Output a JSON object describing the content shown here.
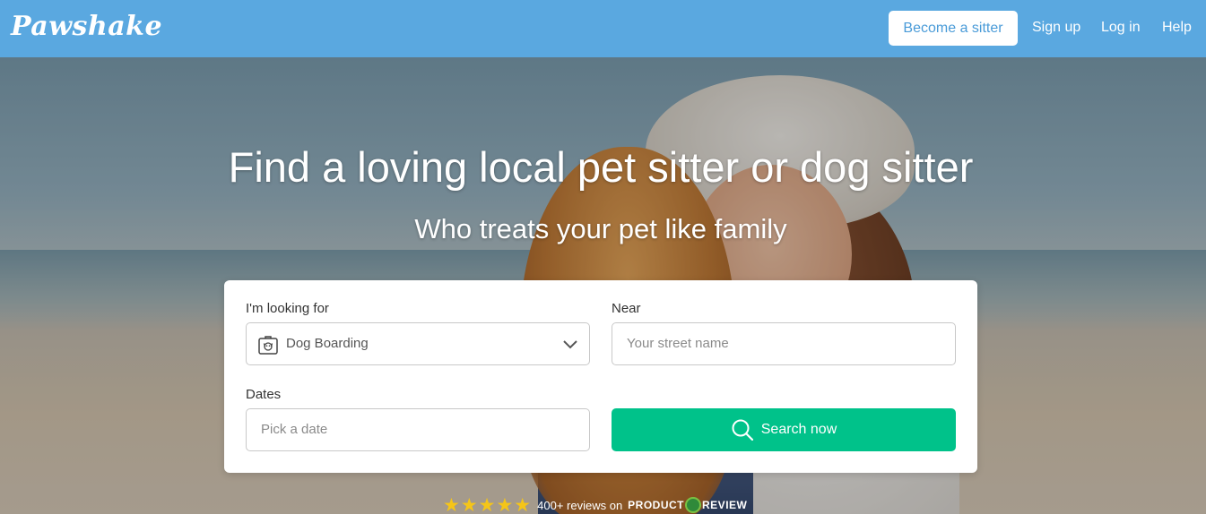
{
  "navbar": {
    "logo": "Pawshake",
    "become_sitter": "Become a sitter",
    "sign_up": "Sign up",
    "log_in": "Log in",
    "help": "Help"
  },
  "hero": {
    "headline": "Find a loving local pet sitter or dog sitter",
    "subheadline": "Who treats your pet like family"
  },
  "search": {
    "looking_for_label": "I'm looking for",
    "service_value": "Dog Boarding",
    "service_icon": "dog-boarding-icon",
    "near_label": "Near",
    "near_placeholder": "Your street name",
    "dates_label": "Dates",
    "dates_placeholder": "Pick a date",
    "search_button": "Search now"
  },
  "reviews": {
    "stars": "★★★★★",
    "rating": 5,
    "text": "400+ reviews on",
    "brand_left": "PRODUCT",
    "brand_right": "REVIEW"
  },
  "colors": {
    "navbar": "#5aa8e0",
    "accent": "#00c28a",
    "star": "#f5c518"
  }
}
